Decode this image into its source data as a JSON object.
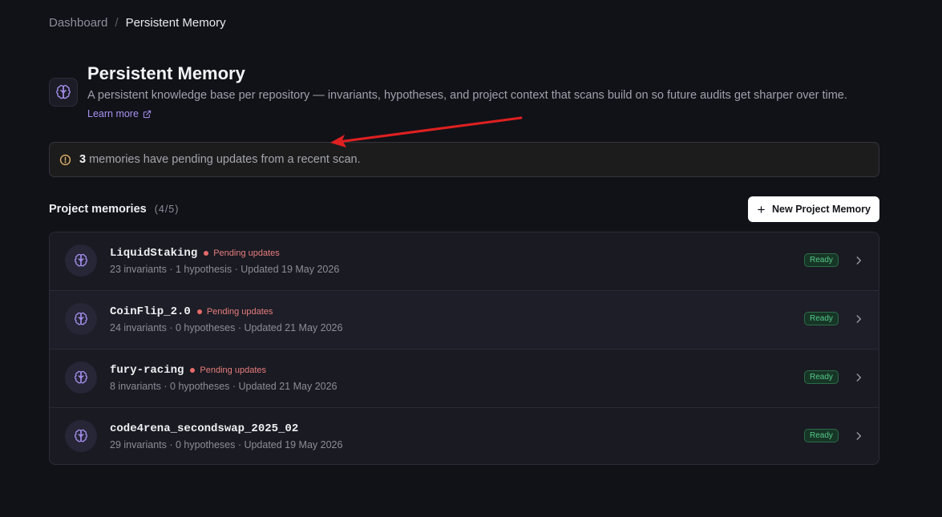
{
  "breadcrumb": {
    "root": "Dashboard",
    "separator": "/",
    "current": "Persistent Memory"
  },
  "header": {
    "icon": "brain-icon",
    "title": "Persistent Memory",
    "description": "A persistent knowledge base per repository — invariants, hypotheses, and project context that scans build on so future audits get sharper over time.",
    "learn_more": "Learn more"
  },
  "alert": {
    "count": "3",
    "message": "memories have pending updates from a recent scan.",
    "icon": "warning-circle-icon",
    "color": "#e0b36a"
  },
  "section": {
    "title": "Project memories",
    "count": "(4/5)",
    "new_button": "New Project Memory"
  },
  "memories": [
    {
      "name": "LiquidStaking",
      "pending": "Pending updates",
      "meta": "23 invariants · 1 hypothesis · Updated 19 May 2026",
      "status": "Ready"
    },
    {
      "name": "CoinFlip_2.0",
      "pending": "Pending updates",
      "meta": "24 invariants · 0 hypotheses · Updated 21 May 2026",
      "status": "Ready"
    },
    {
      "name": "fury-racing",
      "pending": "Pending updates",
      "meta": "8 invariants · 0 hypotheses · Updated 21 May 2026",
      "status": "Ready"
    },
    {
      "name": "code4rena_secondswap_2025_02",
      "pending": "",
      "meta": "29 invariants · 0 hypotheses · Updated 19 May 2026",
      "status": "Ready"
    }
  ],
  "colors": {
    "accent": "#a891f0",
    "pending": "#e87d7d",
    "ready": "#55c98a",
    "annotation": "#e02020"
  }
}
